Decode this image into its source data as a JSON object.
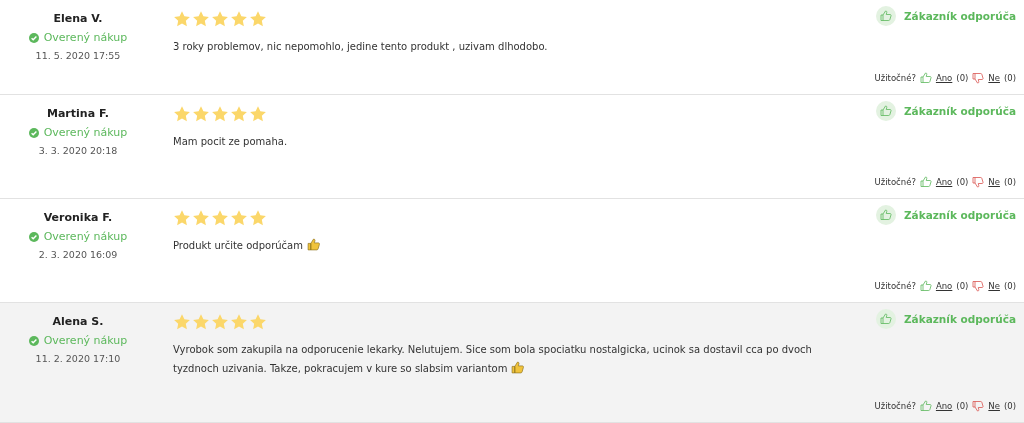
{
  "reviews": [
    {
      "name": "Elena V.",
      "verified": "Overený nákup",
      "date": "11. 5. 2020 17:55",
      "stars": 5,
      "text": "3 roky problemov, nic nepomohlo, jedine tento produkt , uzivam dlhodobo.",
      "thumb_emoji": false,
      "recommend": "Zákazník odporúča",
      "highlighted": false,
      "helpful_label": "Užitočné?",
      "yes": "Ano",
      "yes_count": "(0)",
      "no": "Ne",
      "no_count": "(0)"
    },
    {
      "name": "Martina F.",
      "verified": "Overený nákup",
      "date": "3. 3. 2020 20:18",
      "stars": 5,
      "text": "Mam pocit ze pomaha.",
      "thumb_emoji": false,
      "recommend": "Zákazník odporúča",
      "highlighted": false,
      "helpful_label": "Užitočné?",
      "yes": "Ano",
      "yes_count": "(0)",
      "no": "Ne",
      "no_count": "(0)"
    },
    {
      "name": "Veronika F.",
      "verified": "Overený nákup",
      "date": "2. 3. 2020 16:09",
      "stars": 5,
      "text": "Produkt určite odporúčam",
      "thumb_emoji": true,
      "recommend": "Zákazník odporúča",
      "highlighted": false,
      "helpful_label": "Užitočné?",
      "yes": "Ano",
      "yes_count": "(0)",
      "no": "Ne",
      "no_count": "(0)"
    },
    {
      "name": "Alena S.",
      "verified": "Overený nákup",
      "date": "11. 2. 2020 17:10",
      "stars": 5,
      "text": "Vyrobok som zakupila na odporucenie lekarky. Nelutujem. Sice som bola spociatku nostalgicka, ucinok sa dostavil cca po dvoch tyzdnoch uzivania. Takze, pokracujem v kure so slabsim variantom",
      "thumb_emoji": true,
      "recommend": "Zákazník odporúča",
      "highlighted": true,
      "helpful_label": "Užitočné?",
      "yes": "Ano",
      "yes_count": "(0)",
      "no": "Ne",
      "no_count": "(0)"
    }
  ]
}
